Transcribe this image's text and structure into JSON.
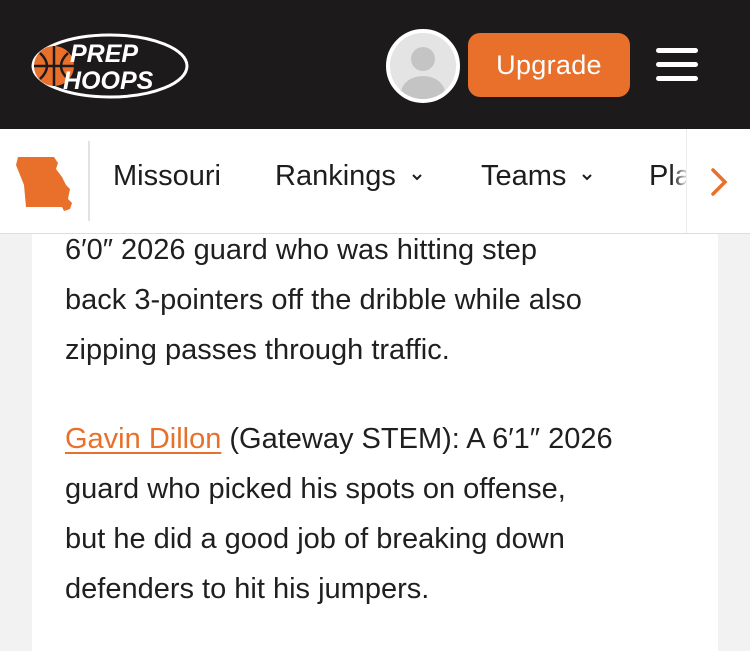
{
  "header": {
    "logo_line1": "PREP",
    "logo_line2": "HOOPS",
    "upgrade_label": "Upgrade",
    "brand_color": "#e8702a",
    "bar_color": "#1c1a1a"
  },
  "subnav": {
    "state_icon": "missouri-state-icon",
    "items": [
      {
        "label": "Missouri",
        "has_dropdown": false
      },
      {
        "label": "Rankings",
        "has_dropdown": true
      },
      {
        "label": "Teams",
        "has_dropdown": true
      },
      {
        "label": "Pla",
        "has_dropdown": false
      }
    ],
    "next_icon": "chevron-right-icon"
  },
  "article": {
    "para1": {
      "lines": [
        "6′0″ 2026 guard who was hitting step",
        "back 3-pointers off the dribble while also",
        "zipping passes through traffic."
      ]
    },
    "para2": {
      "player_link": "Gavin Dillon",
      "line1_rest": " (Gateway STEM): A 6′1″ 2026",
      "lines": [
        "guard who picked his spots on offense,",
        "but he did a good job of breaking down",
        "defenders to hit his jumpers."
      ]
    }
  }
}
